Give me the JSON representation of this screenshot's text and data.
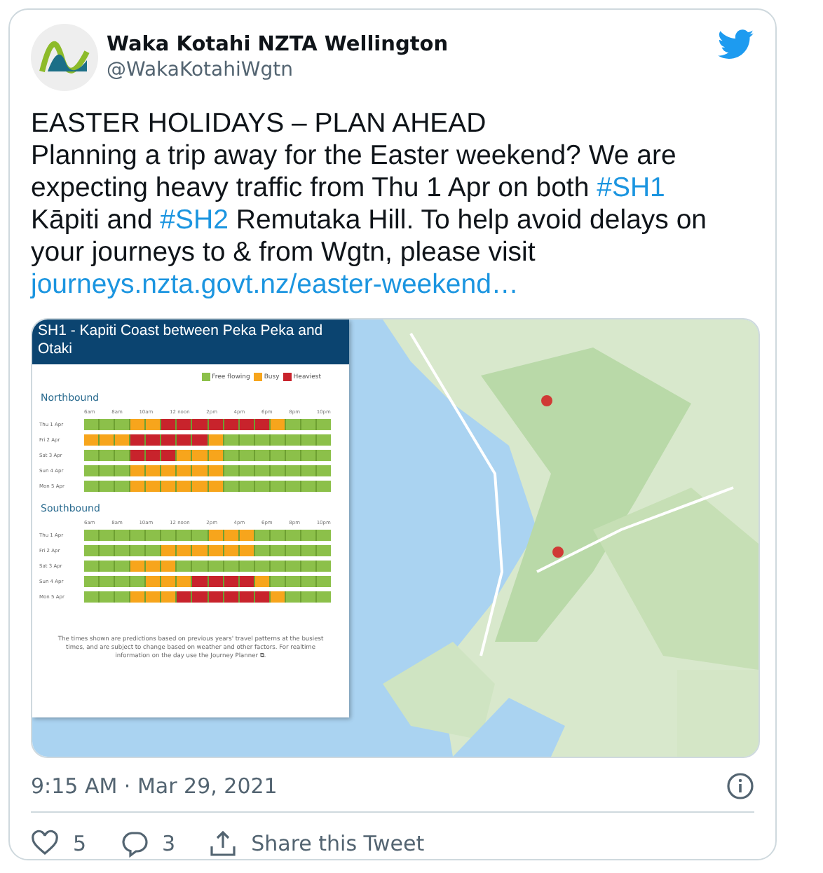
{
  "author": {
    "name": "Waka Kotahi NZTA Wellington",
    "handle": "@WakaKotahiWgtn"
  },
  "headline": "EASTER HOLIDAYS – PLAN AHEAD",
  "body": [
    {
      "kind": "text",
      "text": "Planning a trip away for the Easter weekend? We are expecting heavy traffic from Thu 1 Apr on both "
    },
    {
      "kind": "hashtag",
      "text": "#SH1"
    },
    {
      "kind": "text",
      "text": " Kāpiti and "
    },
    {
      "kind": "hashtag",
      "text": "#SH2"
    },
    {
      "kind": "text",
      "text": " Remutaka Hill. To help avoid delays on your journeys to & from Wgtn, please visit "
    },
    {
      "kind": "url",
      "text": "journeys.nzta.govt.nz/easter-weekend…"
    }
  ],
  "infographic": {
    "title": "SH1 - Kapiti Coast between Peka Peka and Otaki",
    "legend": [
      {
        "label": "Free flowing",
        "kind": "free"
      },
      {
        "label": "Busy",
        "kind": "busy"
      },
      {
        "label": "Heaviest",
        "kind": "heavy"
      }
    ],
    "sections": [
      {
        "title": "Northbound",
        "hours": [
          "6am",
          "8am",
          "10am",
          "12 noon",
          "2pm",
          "4pm",
          "6pm",
          "8pm",
          "10pm"
        ],
        "rows": [
          {
            "day": "Thu 1 Apr",
            "cells": [
              {
                "kind": "free"
              },
              {
                "kind": "free"
              },
              {
                "kind": "free"
              },
              {
                "kind": "busy"
              },
              {
                "kind": "busy"
              },
              {
                "kind": "heavy"
              },
              {
                "kind": "heavy"
              },
              {
                "kind": "heavy"
              },
              {
                "kind": "heavy"
              },
              {
                "kind": "heavy"
              },
              {
                "kind": "heavy"
              },
              {
                "kind": "heavy"
              },
              {
                "kind": "busy"
              },
              {
                "kind": "free"
              },
              {
                "kind": "free"
              },
              {
                "kind": "free"
              }
            ]
          },
          {
            "day": "Fri 2 Apr",
            "cells": [
              {
                "kind": "busy"
              },
              {
                "kind": "busy"
              },
              {
                "kind": "busy"
              },
              {
                "kind": "heavy"
              },
              {
                "kind": "heavy"
              },
              {
                "kind": "heavy"
              },
              {
                "kind": "heavy"
              },
              {
                "kind": "heavy"
              },
              {
                "kind": "busy"
              },
              {
                "kind": "free"
              },
              {
                "kind": "free"
              },
              {
                "kind": "free"
              },
              {
                "kind": "free"
              },
              {
                "kind": "free"
              },
              {
                "kind": "free"
              },
              {
                "kind": "free"
              }
            ]
          },
          {
            "day": "Sat 3 Apr",
            "cells": [
              {
                "kind": "free"
              },
              {
                "kind": "free"
              },
              {
                "kind": "free"
              },
              {
                "kind": "heavy"
              },
              {
                "kind": "heavy"
              },
              {
                "kind": "heavy"
              },
              {
                "kind": "busy"
              },
              {
                "kind": "busy"
              },
              {
                "kind": "busy"
              },
              {
                "kind": "free"
              },
              {
                "kind": "free"
              },
              {
                "kind": "free"
              },
              {
                "kind": "free"
              },
              {
                "kind": "free"
              },
              {
                "kind": "free"
              },
              {
                "kind": "free"
              }
            ]
          },
          {
            "day": "Sun 4 Apr",
            "cells": [
              {
                "kind": "free"
              },
              {
                "kind": "free"
              },
              {
                "kind": "free"
              },
              {
                "kind": "busy"
              },
              {
                "kind": "busy"
              },
              {
                "kind": "busy"
              },
              {
                "kind": "busy"
              },
              {
                "kind": "busy"
              },
              {
                "kind": "busy"
              },
              {
                "kind": "free"
              },
              {
                "kind": "free"
              },
              {
                "kind": "free"
              },
              {
                "kind": "free"
              },
              {
                "kind": "free"
              },
              {
                "kind": "free"
              },
              {
                "kind": "free"
              }
            ]
          },
          {
            "day": "Mon 5 Apr",
            "cells": [
              {
                "kind": "free"
              },
              {
                "kind": "free"
              },
              {
                "kind": "free"
              },
              {
                "kind": "busy"
              },
              {
                "kind": "busy"
              },
              {
                "kind": "busy"
              },
              {
                "kind": "busy"
              },
              {
                "kind": "busy"
              },
              {
                "kind": "busy"
              },
              {
                "kind": "free"
              },
              {
                "kind": "free"
              },
              {
                "kind": "free"
              },
              {
                "kind": "free"
              },
              {
                "kind": "free"
              },
              {
                "kind": "free"
              },
              {
                "kind": "free"
              }
            ]
          }
        ]
      },
      {
        "title": "Southbound",
        "hours": [
          "6am",
          "8am",
          "10am",
          "12 noon",
          "2pm",
          "4pm",
          "6pm",
          "8pm",
          "10pm"
        ],
        "rows": [
          {
            "day": "Thu 1 Apr",
            "cells": [
              {
                "kind": "free"
              },
              {
                "kind": "free"
              },
              {
                "kind": "free"
              },
              {
                "kind": "free"
              },
              {
                "kind": "free"
              },
              {
                "kind": "free"
              },
              {
                "kind": "free"
              },
              {
                "kind": "free"
              },
              {
                "kind": "busy"
              },
              {
                "kind": "busy"
              },
              {
                "kind": "busy"
              },
              {
                "kind": "free"
              },
              {
                "kind": "free"
              },
              {
                "kind": "free"
              },
              {
                "kind": "free"
              },
              {
                "kind": "free"
              }
            ]
          },
          {
            "day": "Fri 2 Apr",
            "cells": [
              {
                "kind": "free"
              },
              {
                "kind": "free"
              },
              {
                "kind": "free"
              },
              {
                "kind": "free"
              },
              {
                "kind": "free"
              },
              {
                "kind": "busy"
              },
              {
                "kind": "busy"
              },
              {
                "kind": "busy"
              },
              {
                "kind": "busy"
              },
              {
                "kind": "busy"
              },
              {
                "kind": "busy"
              },
              {
                "kind": "free"
              },
              {
                "kind": "free"
              },
              {
                "kind": "free"
              },
              {
                "kind": "free"
              },
              {
                "kind": "free"
              }
            ]
          },
          {
            "day": "Sat 3 Apr",
            "cells": [
              {
                "kind": "free"
              },
              {
                "kind": "free"
              },
              {
                "kind": "free"
              },
              {
                "kind": "busy"
              },
              {
                "kind": "busy"
              },
              {
                "kind": "busy"
              },
              {
                "kind": "free"
              },
              {
                "kind": "free"
              },
              {
                "kind": "free"
              },
              {
                "kind": "free"
              },
              {
                "kind": "free"
              },
              {
                "kind": "free"
              },
              {
                "kind": "free"
              },
              {
                "kind": "free"
              },
              {
                "kind": "free"
              },
              {
                "kind": "free"
              }
            ]
          },
          {
            "day": "Sun 4 Apr",
            "cells": [
              {
                "kind": "free"
              },
              {
                "kind": "free"
              },
              {
                "kind": "free"
              },
              {
                "kind": "free"
              },
              {
                "kind": "busy"
              },
              {
                "kind": "busy"
              },
              {
                "kind": "busy"
              },
              {
                "kind": "heavy"
              },
              {
                "kind": "heavy"
              },
              {
                "kind": "heavy"
              },
              {
                "kind": "heavy"
              },
              {
                "kind": "busy"
              },
              {
                "kind": "free"
              },
              {
                "kind": "free"
              },
              {
                "kind": "free"
              },
              {
                "kind": "free"
              }
            ]
          },
          {
            "day": "Mon 5 Apr",
            "cells": [
              {
                "kind": "free"
              },
              {
                "kind": "free"
              },
              {
                "kind": "free"
              },
              {
                "kind": "busy"
              },
              {
                "kind": "busy"
              },
              {
                "kind": "busy"
              },
              {
                "kind": "heavy"
              },
              {
                "kind": "heavy"
              },
              {
                "kind": "heavy"
              },
              {
                "kind": "heavy"
              },
              {
                "kind": "heavy"
              },
              {
                "kind": "heavy"
              },
              {
                "kind": "busy"
              },
              {
                "kind": "free"
              },
              {
                "kind": "free"
              },
              {
                "kind": "free"
              }
            ]
          }
        ]
      }
    ],
    "footnote": "The times shown are predictions based on previous years' travel patterns at the busiest times, and are subject to change based on weather and other factors. For realtime information on the day use the Journey Planner ⧉."
  },
  "timestamp": "9:15 AM · Mar 29, 2021",
  "actions": [
    {
      "kind": "like",
      "label": "5"
    },
    {
      "kind": "reply",
      "label": "3"
    },
    {
      "kind": "share",
      "label": "Share this Tweet"
    }
  ]
}
